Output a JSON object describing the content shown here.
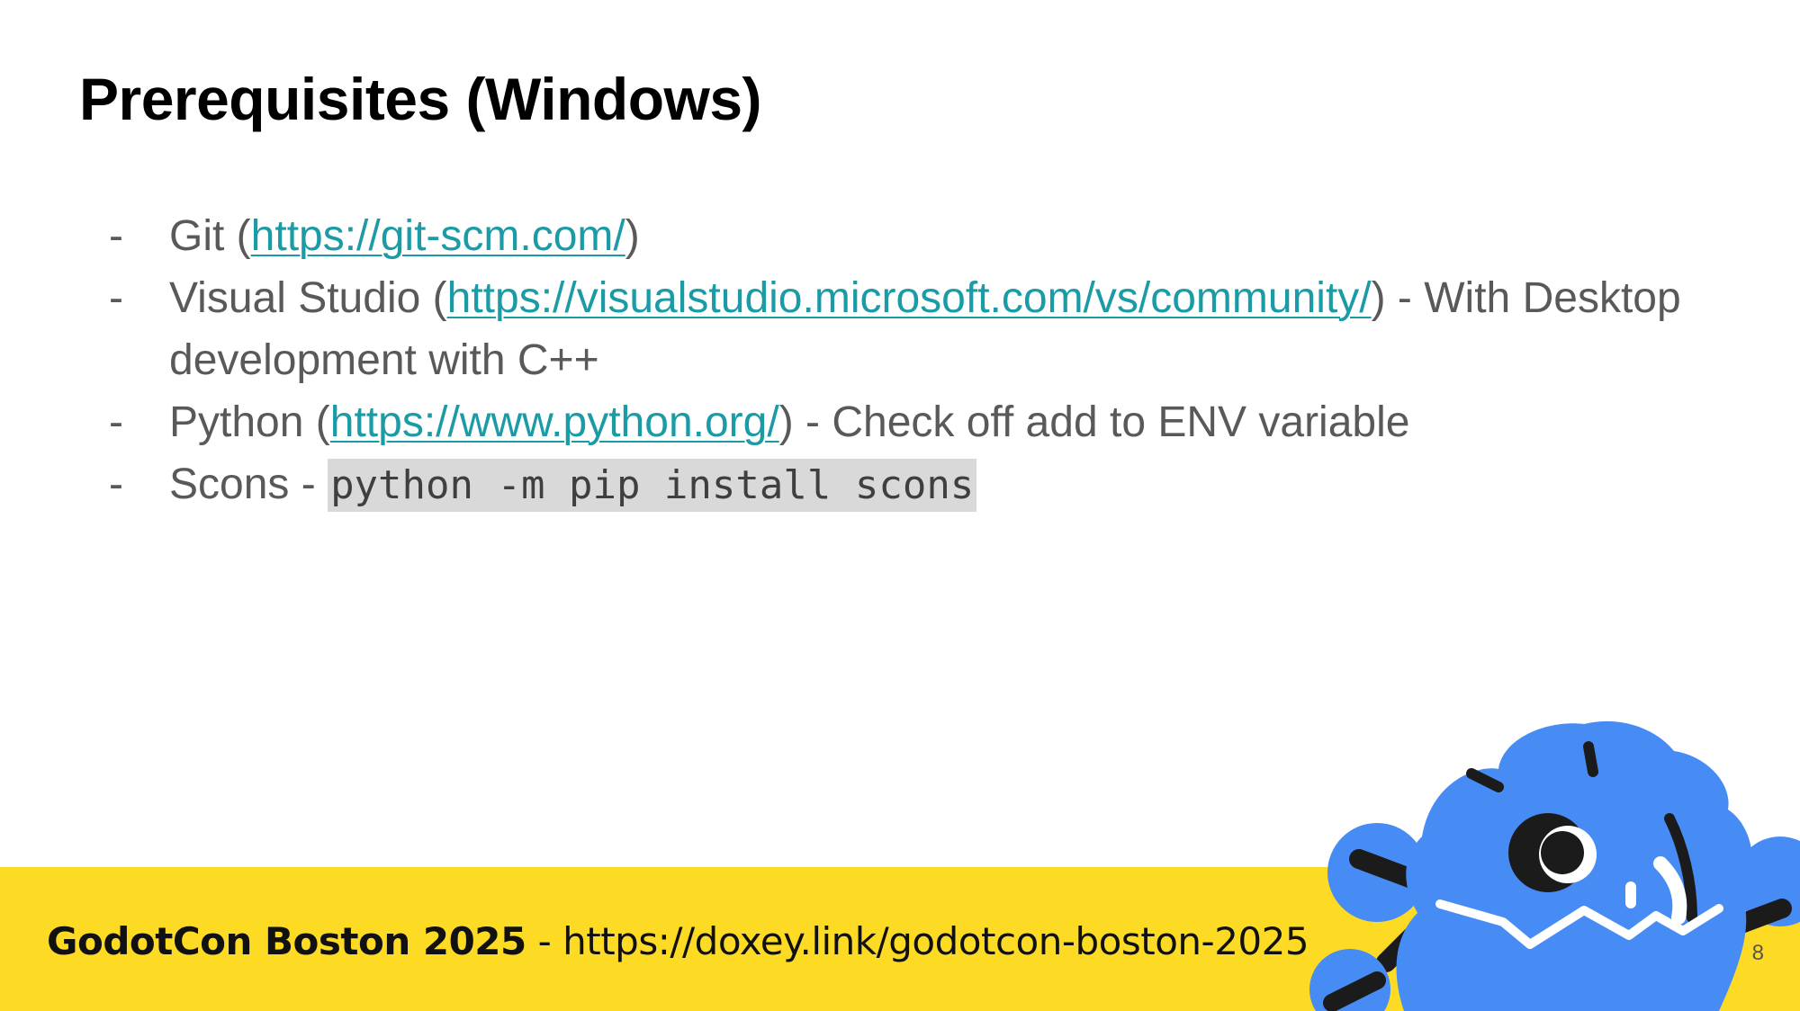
{
  "slide": {
    "title": "Prerequisites (Windows)",
    "bullets": [
      {
        "marker": "-",
        "before": "Git (",
        "link": "https://git-scm.com/",
        "after": ")"
      },
      {
        "marker": "-",
        "before": "Visual Studio (",
        "link": "https://visualstudio.microsoft.com/vs/community/",
        "after": ") - With Desktop development with C++"
      },
      {
        "marker": "-",
        "before": "Python (",
        "link": "https://www.python.org/",
        "after": ") - Check off add to ENV variable"
      },
      {
        "marker": "-",
        "before": "Scons - ",
        "code": "python -m pip install scons"
      }
    ],
    "page_number": "8"
  },
  "footer": {
    "event_name": "GodotCon Boston 2025",
    "separator": " - ",
    "event_link": "https://doxey.link/godotcon-boston-2025"
  },
  "mascot": {
    "icon": "godot-mascot-icon"
  },
  "colors": {
    "footer_background": "#fddb24",
    "link": "#1a9ba5",
    "body_text": "#595959",
    "mascot_blue": "#478cf5"
  }
}
